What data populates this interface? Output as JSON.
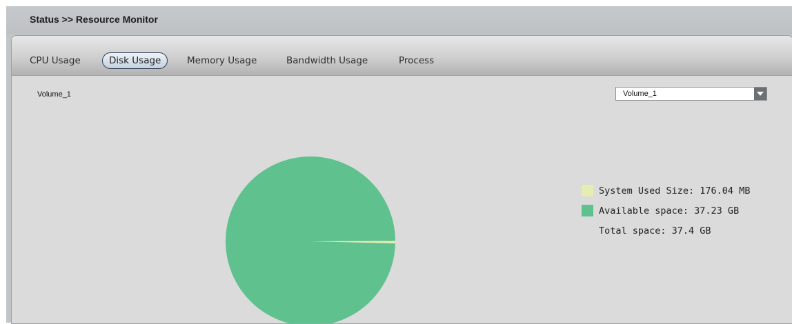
{
  "header": {
    "title": "Status >> Resource Monitor"
  },
  "tabs": [
    {
      "label": "CPU Usage",
      "active": false
    },
    {
      "label": "Disk Usage",
      "active": true
    },
    {
      "label": "Memory Usage",
      "active": false
    },
    {
      "label": "Bandwidth Usage",
      "active": false
    },
    {
      "label": "Process",
      "active": false
    }
  ],
  "volume": {
    "label": "Volume_1",
    "select_value": "Volume_1",
    "dropdown_icon": "chevron-down-icon"
  },
  "legend": {
    "used": "System Used Size: 176.04 MB",
    "available": "Available space: 37.23 GB",
    "total": "Total space: 37.4 GB"
  },
  "colors": {
    "used": "#e5edb0",
    "available": "#5fc18d",
    "select_arrow_bg": "#6c6f73"
  },
  "chart_data": {
    "type": "pie",
    "categories": [
      "System Used Size",
      "Available space"
    ],
    "values": [
      176.04,
      38123.52
    ],
    "units": "MB"
  }
}
